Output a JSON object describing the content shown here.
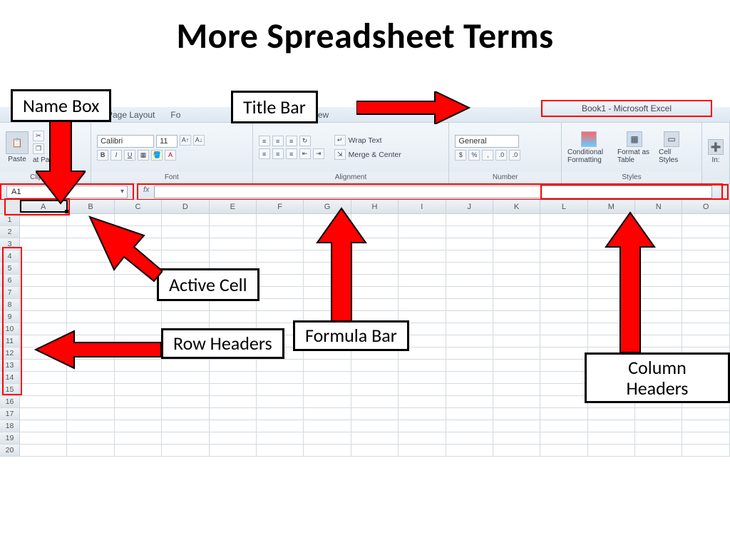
{
  "slide_title": "More Spreadsheet Terms",
  "title_bar": "Book1  -  Microsoft Excel",
  "tabs": {
    "page_layout": "Page Layout",
    "formulas_peek": "Fo",
    "view": "View"
  },
  "ribbon": {
    "clipboard": {
      "paste": "Paste",
      "painter": "at Painter",
      "label": "Clipboard"
    },
    "font": {
      "name": "Calibri",
      "size": "11",
      "label": "Font"
    },
    "alignment": {
      "wrap": "Wrap Text",
      "merge": "Merge & Center",
      "label": "Alignment"
    },
    "number": {
      "format": "General",
      "label": "Number"
    },
    "styles": {
      "cond": "Conditional Formatting",
      "table": "Format as Table",
      "cell": "Cell Styles",
      "label": "Styles",
      "ins": "In:"
    }
  },
  "name_box": "A1",
  "fx_label": "fx",
  "columns": [
    "A",
    "B",
    "C",
    "D",
    "E",
    "F",
    "G",
    "H",
    "I",
    "J",
    "K",
    "L",
    "M",
    "N",
    "O"
  ],
  "rows": [
    "1",
    "2",
    "3",
    "4",
    "5",
    "6",
    "7",
    "8",
    "9",
    "10",
    "11",
    "12",
    "13",
    "14",
    "15",
    "16",
    "17",
    "18",
    "19",
    "20"
  ],
  "callouts": {
    "name_box": "Name Box",
    "title_bar": "Title Bar",
    "active_cell": "Active Cell",
    "formula_bar": "Formula Bar",
    "row_headers": "Row Headers",
    "column_headers": "Column Headers"
  }
}
